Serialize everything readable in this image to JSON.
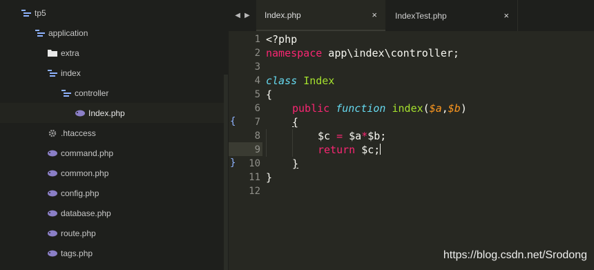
{
  "sidebar": {
    "items": [
      {
        "label": "tp5",
        "icon": "folder-open-icon",
        "depth": 0
      },
      {
        "label": "application",
        "icon": "folder-open-icon",
        "depth": 1
      },
      {
        "label": "extra",
        "icon": "folder-icon",
        "depth": 2
      },
      {
        "label": "index",
        "icon": "folder-open-icon",
        "depth": 2
      },
      {
        "label": "controller",
        "icon": "folder-open-icon",
        "depth": 3
      },
      {
        "label": "Index.php",
        "icon": "php-file-icon",
        "depth": 4,
        "selected": true
      },
      {
        "label": ".htaccess",
        "icon": "gear-icon",
        "depth": 2
      },
      {
        "label": "command.php",
        "icon": "php-file-icon",
        "depth": 2
      },
      {
        "label": "common.php",
        "icon": "php-file-icon",
        "depth": 2
      },
      {
        "label": "config.php",
        "icon": "php-file-icon",
        "depth": 2
      },
      {
        "label": "database.php",
        "icon": "php-file-icon",
        "depth": 2
      },
      {
        "label": "route.php",
        "icon": "php-file-icon",
        "depth": 2
      },
      {
        "label": "tags.php",
        "icon": "php-file-icon",
        "depth": 2
      }
    ]
  },
  "tabs": {
    "nav_left": "◀",
    "nav_right": "▶",
    "items": [
      {
        "label": "Index.php",
        "close": "×",
        "active": true
      },
      {
        "label": "IndexTest.php",
        "close": "×",
        "active": false
      }
    ]
  },
  "editor": {
    "line_numbers": [
      "1",
      "2",
      "3",
      "4",
      "5",
      "6",
      "7",
      "8",
      "9",
      "10",
      "11",
      "12"
    ],
    "fold_open": "{",
    "fold_close": "}",
    "lines": {
      "l1": "<?php",
      "l2_kw": "namespace",
      "l2_rest": " app\\index\\controller;",
      "l4_kw": "class",
      "l4_name": "Index",
      "l5": "{",
      "l6_kw1": "public",
      "l6_kw2": "function",
      "l6_fn": "index",
      "l6_open": "(",
      "l6_a": "$a",
      "l6_comma": ",",
      "l6_b": "$b",
      "l6_close": ")",
      "l7": "{",
      "l8_c": "$c",
      "l8_eq": "=",
      "l8_a": "$a",
      "l8_mul": "*",
      "l8_rest": "$b;",
      "l9_kw": "return",
      "l9_rest": " $c;",
      "l10": "}",
      "l11": "}"
    }
  },
  "watermark": "https://blog.csdn.net/Srodong",
  "colors": {
    "sidebar_bg": "#1e1f1c",
    "editor_bg": "#272822",
    "keyword": "#f92672",
    "storage": "#66d9ef",
    "function": "#a6e22e",
    "parameter": "#fd971f"
  }
}
